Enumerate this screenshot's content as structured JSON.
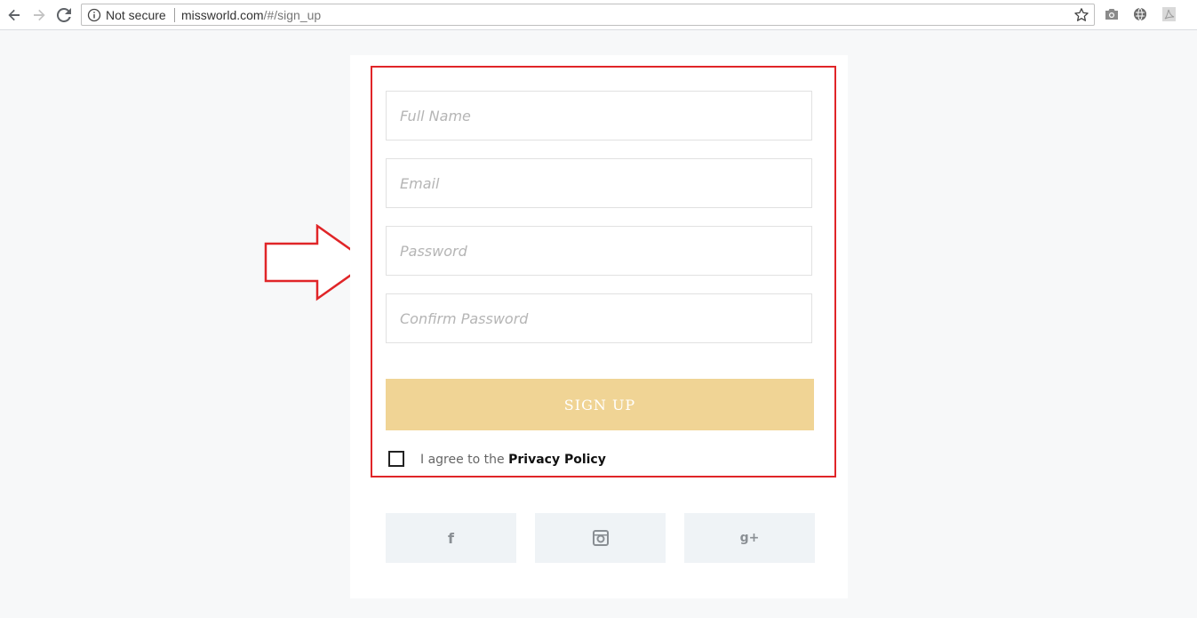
{
  "browser": {
    "security_label": "Not secure",
    "url_host": "missworld.com",
    "url_path": "/#/sign_up"
  },
  "form": {
    "fields": [
      {
        "placeholder": "Full Name",
        "value": ""
      },
      {
        "placeholder": "Email",
        "value": ""
      },
      {
        "placeholder": "Password",
        "value": ""
      },
      {
        "placeholder": "Confirm Password",
        "value": ""
      }
    ],
    "submit_label": "SIGN UP",
    "agree_prefix": "I agree to the ",
    "agree_link": "Privacy Policy",
    "agree_checked": false
  },
  "social": [
    {
      "name": "facebook-icon",
      "glyph": "f"
    },
    {
      "name": "instagram-icon",
      "glyph": ""
    },
    {
      "name": "google-plus-icon",
      "glyph": "g+"
    }
  ],
  "colors": {
    "accent": "#f0d495",
    "highlight": "#e02528",
    "social_bg": "#eff3f6",
    "page_bg": "#f7f8f9"
  }
}
